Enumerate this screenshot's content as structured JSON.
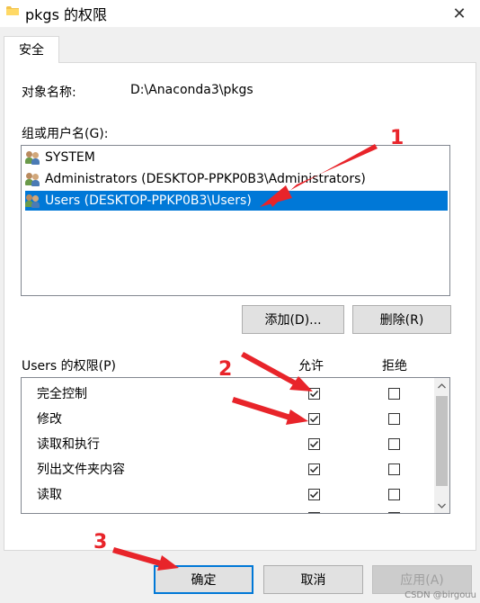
{
  "window": {
    "title": "pkgs 的权限",
    "close_glyph": "✕"
  },
  "tab": {
    "label": "安全"
  },
  "object": {
    "label": "对象名称:",
    "value": "D:\\Anaconda3\\pkgs"
  },
  "groups": {
    "label": "组或用户名(G):",
    "items": [
      {
        "label": "SYSTEM",
        "icon": "user-group-icon",
        "selected": false
      },
      {
        "label": "Administrators (DESKTOP-PPKP0B3\\Administrators)",
        "icon": "user-group-icon",
        "selected": false
      },
      {
        "label": "Users (DESKTOP-PPKP0B3\\Users)",
        "icon": "user-group-icon",
        "selected": true
      }
    ]
  },
  "buttons": {
    "add": "添加(D)...",
    "remove": "删除(R)",
    "ok": "确定",
    "cancel": "取消",
    "apply": "应用(A)"
  },
  "permissions": {
    "label": "Users 的权限(P)",
    "allow_header": "允许",
    "deny_header": "拒绝",
    "rows": [
      {
        "name": "完全控制",
        "allow": true,
        "deny": false
      },
      {
        "name": "修改",
        "allow": true,
        "deny": false
      },
      {
        "name": "读取和执行",
        "allow": true,
        "deny": false
      },
      {
        "name": "列出文件夹内容",
        "allow": true,
        "deny": false
      },
      {
        "name": "读取",
        "allow": true,
        "deny": false
      }
    ]
  },
  "annotations": {
    "marker1": "1",
    "marker2": "2",
    "marker3": "3"
  },
  "watermark": "CSDN @birgouu",
  "colors": {
    "selection": "#0078d7",
    "annotation": "#e8242a"
  }
}
